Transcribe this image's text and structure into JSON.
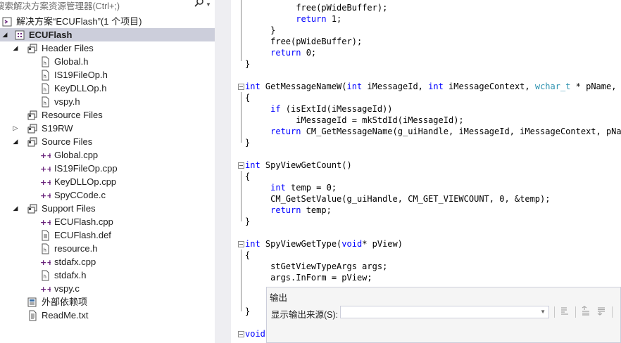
{
  "solution_explorer": {
    "search_placeholder": "搜索解决方案资源管理器(Ctrl+;)",
    "items": [
      {
        "label": "解决方案“ECUFlash”(1 个项目)",
        "kind": "solution"
      },
      {
        "label": "ECUFlash",
        "kind": "project",
        "expander": "expanded",
        "selected": true
      },
      {
        "label": "Header Files",
        "kind": "filter",
        "expander": "expanded"
      },
      {
        "label": "Global.h",
        "kind": "header"
      },
      {
        "label": "IS19FileOp.h",
        "kind": "header"
      },
      {
        "label": "KeyDLLOp.h",
        "kind": "header"
      },
      {
        "label": "vspy.h",
        "kind": "header"
      },
      {
        "label": "Resource Files",
        "kind": "filter"
      },
      {
        "label": "S19RW",
        "kind": "filter",
        "expander": "collapsed"
      },
      {
        "label": "Source Files",
        "kind": "filter",
        "expander": "expanded"
      },
      {
        "label": "Global.cpp",
        "kind": "cpp"
      },
      {
        "label": "IS19FileOp.cpp",
        "kind": "cpp"
      },
      {
        "label": "KeyDLLOp.cpp",
        "kind": "cpp"
      },
      {
        "label": "SpyCCode.c",
        "kind": "cpp"
      },
      {
        "label": "Support Files",
        "kind": "filter",
        "expander": "expanded"
      },
      {
        "label": "ECUFlash.cpp",
        "kind": "cpp"
      },
      {
        "label": "ECUFlash.def",
        "kind": "def"
      },
      {
        "label": "resource.h",
        "kind": "header"
      },
      {
        "label": "stdafx.cpp",
        "kind": "cpp"
      },
      {
        "label": "stdafx.h",
        "kind": "header"
      },
      {
        "label": "vspy.c",
        "kind": "cpp"
      },
      {
        "label": "外部依赖项",
        "kind": "deps"
      },
      {
        "label": "ReadMe.txt",
        "kind": "text"
      }
    ]
  },
  "code": {
    "lines": [
      {
        "text": "          free(pWideBuffer);"
      },
      {
        "text": "          return 1;"
      },
      {
        "text": "     }"
      },
      {
        "text": "     free(pWideBuffer);"
      },
      {
        "text": "     return 0;"
      },
      {
        "text": "}"
      },
      {
        "text": ""
      },
      {
        "text": "int GetMessageNameW(int iMessageId, int iMessageContext, wchar_t * pName, int"
      },
      {
        "text": "{"
      },
      {
        "text": "     if (isExtId(iMessageId))"
      },
      {
        "text": "          iMessageId = mkStdId(iMessageId);"
      },
      {
        "text": "     return CM_GetMessageName(g_uiHandle, iMessageId, iMessageContext, pName,"
      },
      {
        "text": "}"
      },
      {
        "text": ""
      },
      {
        "text": "int SpyViewGetCount()"
      },
      {
        "text": "{"
      },
      {
        "text": "     int temp = 0;"
      },
      {
        "text": "     CM_GetSetValue(g_uiHandle, CM_GET_VIEWCOUNT, 0, &temp);"
      },
      {
        "text": "     return temp;"
      },
      {
        "text": "}"
      },
      {
        "text": ""
      },
      {
        "text": "int SpyViewGetType(void* pView)"
      },
      {
        "text": "{"
      },
      {
        "text": "     stGetViewTypeArgs args;"
      },
      {
        "text": "     args.InForm = pView;"
      },
      {
        "text": ""
      },
      {
        "text": ""
      },
      {
        "text": "}"
      },
      {
        "text": ""
      },
      {
        "text": "void"
      }
    ],
    "keywords": [
      "int",
      "return",
      "if",
      "void"
    ],
    "types": [
      "wchar_t"
    ]
  },
  "output_panel": {
    "title": "输出",
    "source_label": "显示输出来源(S):",
    "source_value": ""
  },
  "colors": {
    "selection": "#cccedb",
    "keyword": "#0000ff",
    "type": "#2b91af",
    "cpp_icon": "#68217a",
    "folder_icon": "#424242"
  }
}
